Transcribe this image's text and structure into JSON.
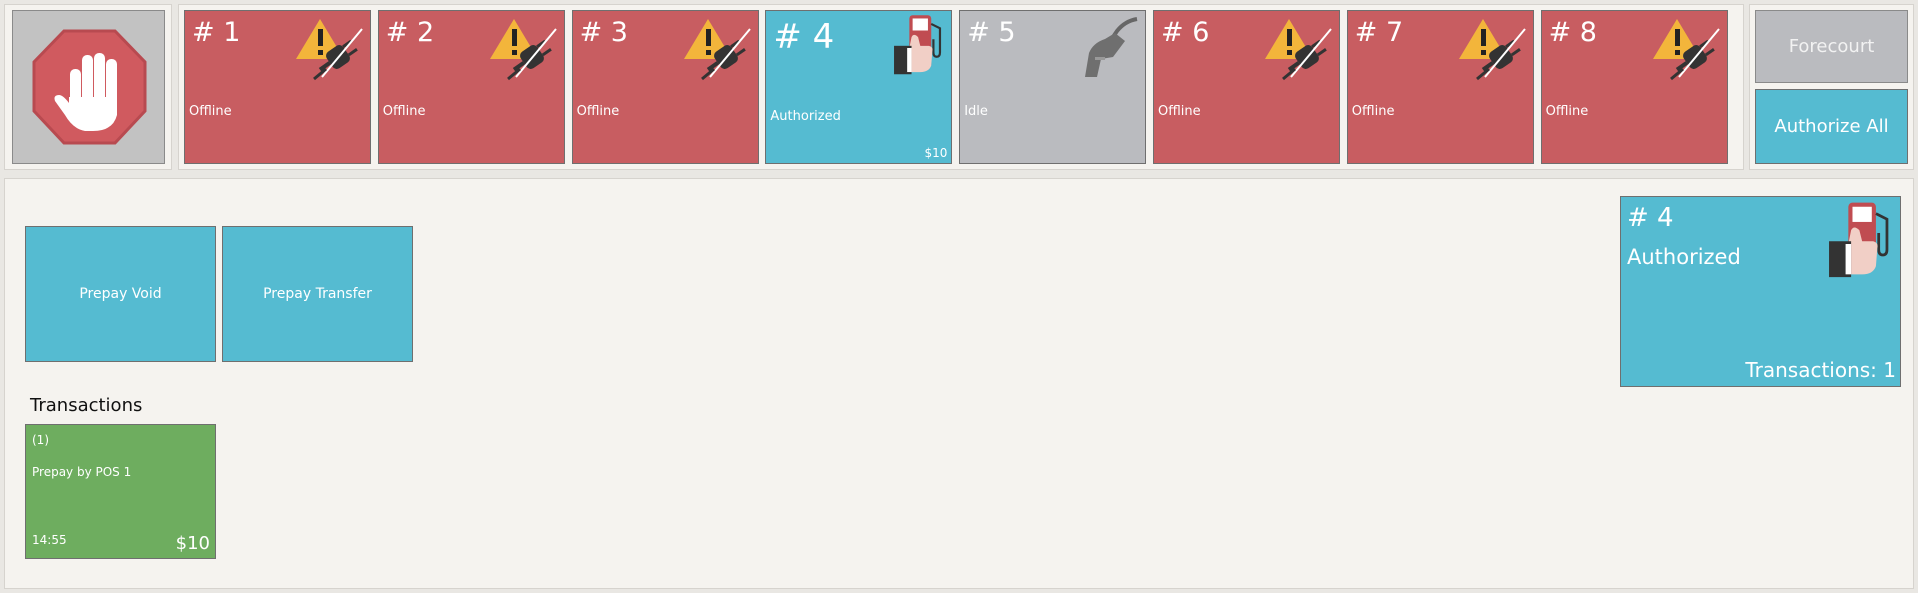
{
  "stop": {
    "icon": "stop-hand-icon"
  },
  "pumps": [
    {
      "number": "# 1",
      "status": "Offline",
      "amount": "",
      "state": "offline",
      "icon": "offline-warning-plug-icon"
    },
    {
      "number": "# 2",
      "status": "Offline",
      "amount": "",
      "state": "offline",
      "icon": "offline-warning-plug-icon"
    },
    {
      "number": "# 3",
      "status": "Offline",
      "amount": "",
      "state": "offline",
      "icon": "offline-warning-plug-icon"
    },
    {
      "number": "# 4",
      "status": "Authorized",
      "amount": "$10",
      "state": "authorized",
      "icon": "fuel-pump-thumbs-up-icon"
    },
    {
      "number": "# 5",
      "status": "Idle",
      "amount": "",
      "state": "idle",
      "icon": "fuel-nozzle-icon"
    },
    {
      "number": "# 6",
      "status": "Offline",
      "amount": "",
      "state": "offline",
      "icon": "offline-warning-plug-icon"
    },
    {
      "number": "# 7",
      "status": "Offline",
      "amount": "",
      "state": "offline",
      "icon": "offline-warning-plug-icon"
    },
    {
      "number": "# 8",
      "status": "Offline",
      "amount": "",
      "state": "offline",
      "icon": "offline-warning-plug-icon"
    }
  ],
  "actions": {
    "forecourt": "Forecourt",
    "authorize_all": "Authorize All"
  },
  "buttons": {
    "prepay_void": "Prepay Void",
    "prepay_transfer": "Prepay Transfer"
  },
  "transactions": {
    "heading": "Transactions",
    "items": [
      {
        "index": "(1)",
        "description": "Prepay by POS 1",
        "time": "14:55",
        "amount": "$10"
      }
    ]
  },
  "selected_pump": {
    "number": "# 4",
    "status": "Authorized",
    "transactions_label": "Transactions: 1",
    "icon": "fuel-pump-thumbs-up-icon"
  },
  "colors": {
    "offline": "#c85d61",
    "authorized": "#55bbd1",
    "idle": "#babbbf",
    "transaction": "#6ead5f",
    "stop": "#d05a5f"
  }
}
